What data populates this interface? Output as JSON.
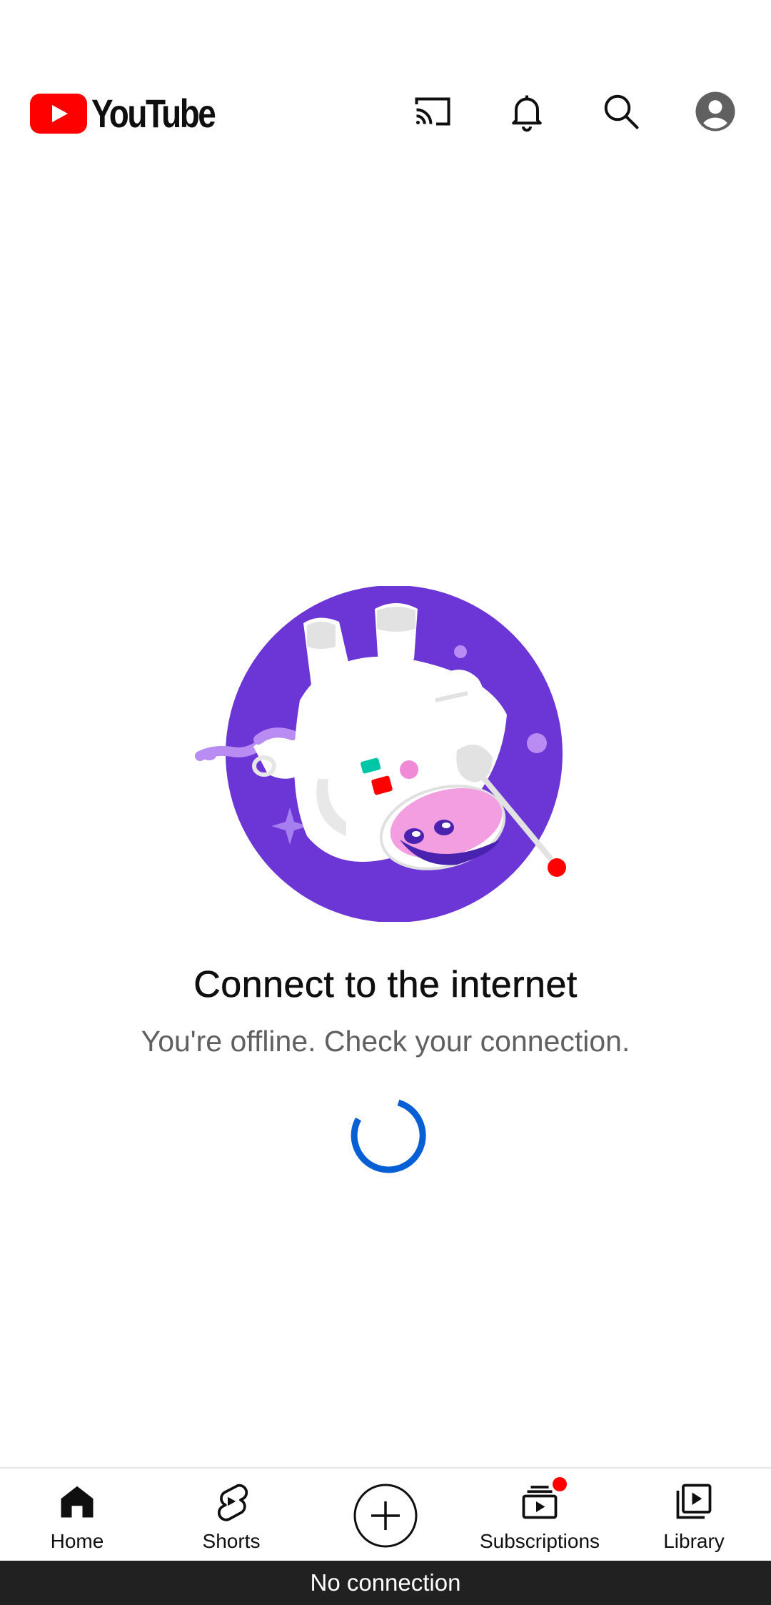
{
  "app": {
    "logo_text": "YouTube",
    "brand_color": "#ff0000"
  },
  "header": {
    "icons": [
      "cast-icon",
      "notifications-icon",
      "search-icon",
      "account-icon"
    ]
  },
  "offline": {
    "title": "Connect to the internet",
    "message": "You're offline. Check your connection."
  },
  "bottom_nav": {
    "items": [
      {
        "label": "Home",
        "icon": "home-icon"
      },
      {
        "label": "Shorts",
        "icon": "shorts-icon"
      },
      {
        "label": "",
        "icon": "create-icon"
      },
      {
        "label": "Subscriptions",
        "icon": "subscriptions-icon"
      },
      {
        "label": "Library",
        "icon": "library-icon"
      }
    ]
  },
  "status_banner": {
    "text": "No connection"
  },
  "colors": {
    "accent": "#065fd4",
    "illustration_purple": "#6c35d6",
    "offline_bar": "#212121"
  }
}
